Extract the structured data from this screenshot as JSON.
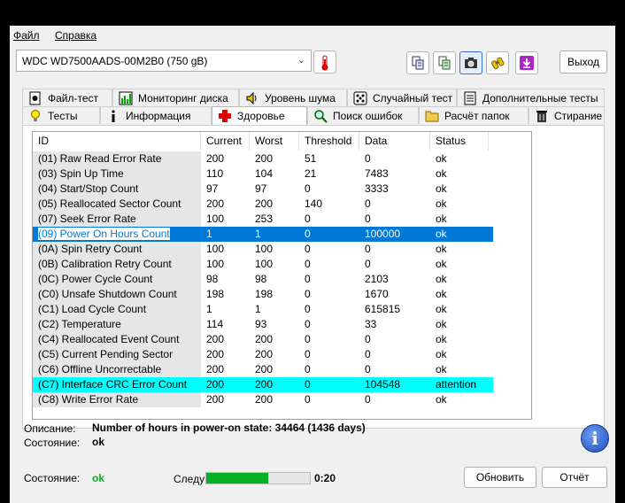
{
  "menu": {
    "file": "Файл",
    "help": "Справка"
  },
  "drive": {
    "selected": "WDC WD7500AADS-00M2B0 (750 gB)"
  },
  "buttons": {
    "exit": "Выход",
    "refresh": "Обновить",
    "report": "Отчёт"
  },
  "tabs_top": [
    "Файл-тест",
    "Мониторинг диска",
    "Уровень шума",
    "Случайный тест",
    "Дополнительные тесты"
  ],
  "tabs_bottom": [
    "Тесты",
    "Информация",
    "Здоровье",
    "Поиск ошибок",
    "Расчёт папок",
    "Стирание"
  ],
  "active_tab": "Здоровье",
  "table": {
    "headers": [
      "ID",
      "Current",
      "Worst",
      "Threshold",
      "Data",
      "Status"
    ],
    "rows": [
      [
        "(01) Raw Read Error Rate",
        "200",
        "200",
        "51",
        "0",
        "ok"
      ],
      [
        "(03) Spin Up Time",
        "110",
        "104",
        "21",
        "7483",
        "ok"
      ],
      [
        "(04) Start/Stop Count",
        "97",
        "97",
        "0",
        "3333",
        "ok"
      ],
      [
        "(05) Reallocated Sector Count",
        "200",
        "200",
        "140",
        "0",
        "ok"
      ],
      [
        "(07) Seek Error Rate",
        "100",
        "253",
        "0",
        "0",
        "ok"
      ],
      [
        "(09) Power On Hours Count",
        "1",
        "1",
        "0",
        "100000",
        "ok"
      ],
      [
        "(0A) Spin Retry Count",
        "100",
        "100",
        "0",
        "0",
        "ok"
      ],
      [
        "(0B) Calibration Retry Count",
        "100",
        "100",
        "0",
        "0",
        "ok"
      ],
      [
        "(0C) Power Cycle Count",
        "98",
        "98",
        "0",
        "2103",
        "ok"
      ],
      [
        "(C0) Unsafe Shutdown Count",
        "198",
        "198",
        "0",
        "1670",
        "ok"
      ],
      [
        "(C1) Load Cycle Count",
        "1",
        "1",
        "0",
        "615815",
        "ok"
      ],
      [
        "(C2) Temperature",
        "114",
        "93",
        "0",
        "33",
        "ok"
      ],
      [
        "(C4) Reallocated Event Count",
        "200",
        "200",
        "0",
        "0",
        "ok"
      ],
      [
        "(C5) Current Pending Sector",
        "200",
        "200",
        "0",
        "0",
        "ok"
      ],
      [
        "(C6) Offline Uncorrectable",
        "200",
        "200",
        "0",
        "0",
        "ok"
      ],
      [
        "(C7) Interface CRC Error Count",
        "200",
        "200",
        "0",
        "104548",
        "attention"
      ],
      [
        "(C8) Write Error Rate",
        "200",
        "200",
        "0",
        "0",
        "ok"
      ]
    ],
    "selected_row": 5,
    "attention_row": 15
  },
  "details": {
    "description_label": "Описание:",
    "description_value": "Number of hours in power-on state: 34464 (1436 days)",
    "state_label": "Состояние:",
    "state_value": "ok"
  },
  "footer": {
    "state_label": "Состояние:",
    "state_value": "ok",
    "next_label": "Следую",
    "progress_fraction": 0.6,
    "time": "0:20"
  },
  "colors": {
    "selected": "#0078d7",
    "attention": "#00ffff",
    "ok_green": "#06b025",
    "info_blue": "#2a63d4"
  },
  "icons": {
    "thermometer": "thermometer-icon",
    "copy": "copy-icon",
    "copy2": "copy-text-icon",
    "screenshot": "camera-icon",
    "binoculars": "binoculars-icon",
    "download": "download-icon",
    "info": "info-icon"
  }
}
